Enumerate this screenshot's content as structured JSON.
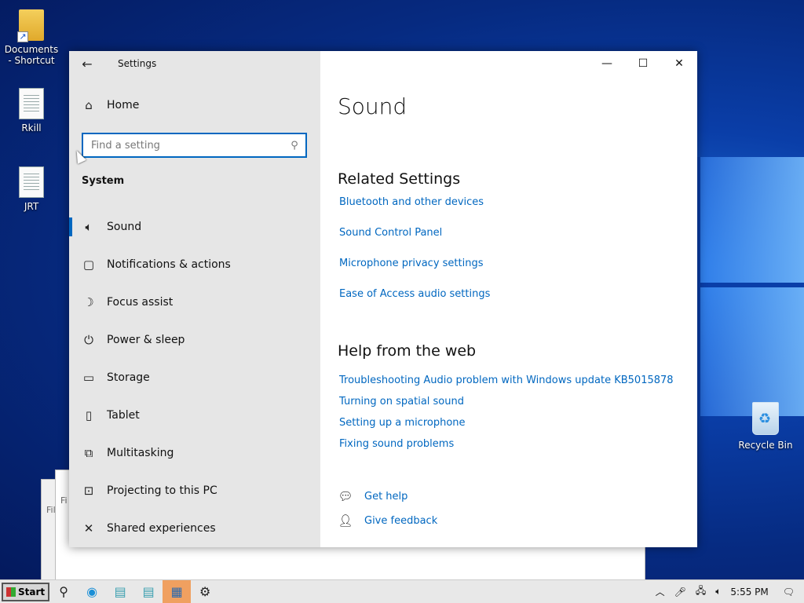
{
  "desktop": {
    "icons": [
      {
        "label": "Documents - Shortcut",
        "icon": "folder-shortcut-icon"
      },
      {
        "label": "Rkill",
        "icon": "document-icon"
      },
      {
        "label": "JRT",
        "icon": "document-icon"
      }
    ],
    "recycle_bin": {
      "label": "Recycle Bin",
      "icon": "recycle-bin-icon"
    },
    "background_fragments": [
      "Fil",
      "Fi"
    ]
  },
  "settings": {
    "window_title": "Settings",
    "home_label": "Home",
    "search_placeholder": "Find a setting",
    "section_label": "System",
    "nav_items": [
      {
        "label": "Sound",
        "icon": "speaker-icon",
        "active": true
      },
      {
        "label": "Notifications & actions",
        "icon": "notification-icon"
      },
      {
        "label": "Focus assist",
        "icon": "moon-icon"
      },
      {
        "label": "Power & sleep",
        "icon": "power-icon"
      },
      {
        "label": "Storage",
        "icon": "storage-icon"
      },
      {
        "label": "Tablet",
        "icon": "tablet-icon"
      },
      {
        "label": "Multitasking",
        "icon": "multitasking-icon"
      },
      {
        "label": "Projecting to this PC",
        "icon": "projector-icon"
      },
      {
        "label": "Shared experiences",
        "icon": "share-icon"
      }
    ],
    "main": {
      "page_title": "Sound",
      "related_heading": "Related Settings",
      "related_links": [
        "Bluetooth and other devices",
        "Sound Control Panel",
        "Microphone privacy settings",
        "Ease of Access audio settings"
      ],
      "help_heading": "Help from the web",
      "help_links": [
        "Troubleshooting Audio problem with Windows update KB5015878",
        "Turning on spatial sound",
        "Setting up a microphone",
        "Fixing sound problems"
      ],
      "get_help": "Get help",
      "give_feedback": "Give feedback"
    }
  },
  "taskbar": {
    "start_label": "Start",
    "clock": "5:55 PM"
  }
}
